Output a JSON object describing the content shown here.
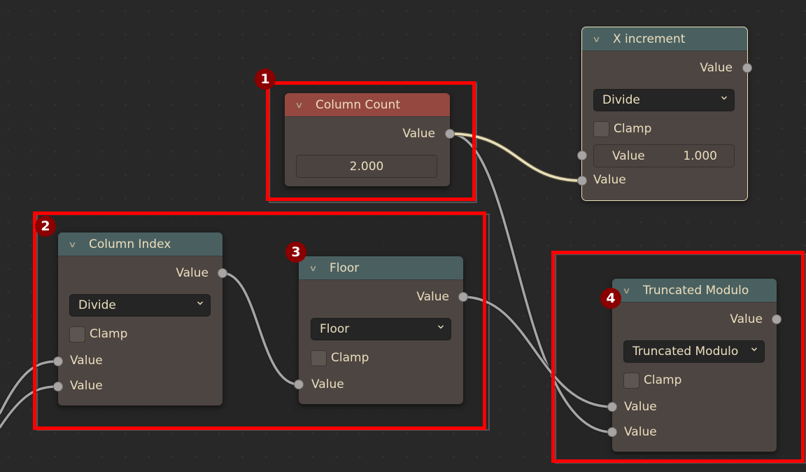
{
  "editor": "Blender Geometry Nodes Editor",
  "annotations": [
    {
      "number": "1",
      "target": "Column Count"
    },
    {
      "number": "2",
      "target": "Column Index"
    },
    {
      "number": "3",
      "target": "Floor"
    },
    {
      "number": "4",
      "target": "Truncated Modulo"
    }
  ],
  "colors": {
    "highlight": "#ff0000",
    "badge": "#8b0000",
    "header_teal": "#4a6060",
    "header_red": "#944840",
    "node_body": "#4d4542",
    "background": "#282828",
    "selected_link": "#e8e0b8",
    "link": "#a6a5a5"
  },
  "nodes": {
    "column_count": {
      "title": "Column Count",
      "output_label": "Value",
      "value": "2.000"
    },
    "x_increment": {
      "title": "X increment",
      "output_label": "Value",
      "operation": "Divide",
      "clamp_label": "Clamp",
      "clamp_checked": false,
      "input1_label": "Value",
      "input1_value": "1.000",
      "input2_label": "Value"
    },
    "column_index": {
      "title": "Column Index",
      "output_label": "Value",
      "operation": "Divide",
      "clamp_label": "Clamp",
      "clamp_checked": false,
      "input1_label": "Value",
      "input2_label": "Value"
    },
    "floor": {
      "title": "Floor",
      "output_label": "Value",
      "operation": "Floor",
      "clamp_label": "Clamp",
      "clamp_checked": false,
      "input1_label": "Value"
    },
    "truncated_modulo": {
      "title": "Truncated Modulo",
      "output_label": "Value",
      "operation": "Truncated Modulo",
      "clamp_label": "Clamp",
      "clamp_checked": false,
      "input1_label": "Value",
      "input2_label": "Value"
    }
  }
}
